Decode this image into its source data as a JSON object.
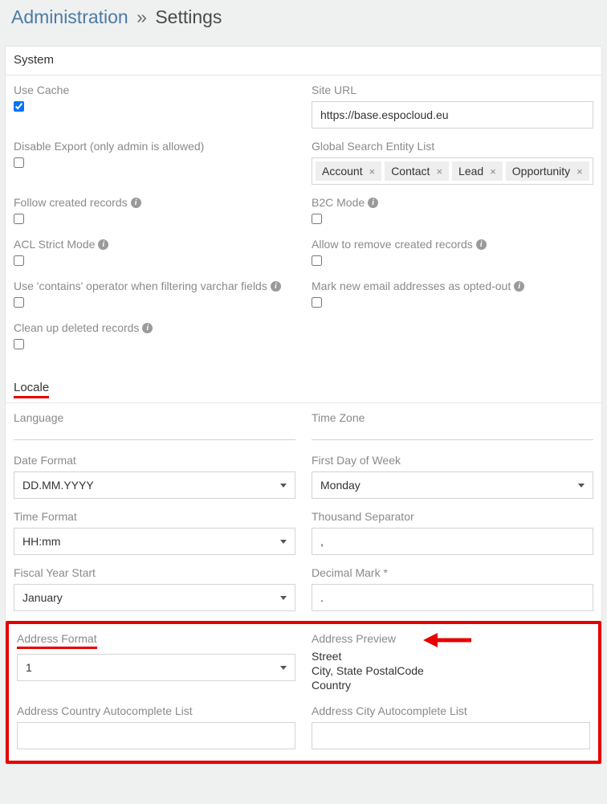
{
  "header": {
    "admin_link": "Administration",
    "separator": "»",
    "page_title": "Settings"
  },
  "sections": {
    "system": {
      "title": "System",
      "use_cache": {
        "label": "Use Cache",
        "checked": true
      },
      "site_url": {
        "label": "Site URL",
        "value": "https://base.espocloud.eu"
      },
      "disable_export": {
        "label": "Disable Export (only admin is allowed)",
        "checked": false
      },
      "global_search": {
        "label": "Global Search Entity List",
        "tags": [
          "Account",
          "Contact",
          "Lead",
          "Opportunity"
        ]
      },
      "follow_created": {
        "label": "Follow created records",
        "checked": false
      },
      "b2c_mode": {
        "label": "B2C Mode",
        "checked": false
      },
      "acl_strict": {
        "label": "ACL Strict Mode",
        "checked": false
      },
      "allow_remove_created": {
        "label": "Allow to remove created records",
        "checked": false
      },
      "contains_operator": {
        "label": "Use 'contains' operator when filtering varchar fields",
        "checked": false
      },
      "mark_opted_out": {
        "label": "Mark new email addresses as opted-out",
        "checked": false
      },
      "clean_deleted": {
        "label": "Clean up deleted records",
        "checked": false
      }
    },
    "locale": {
      "title": "Locale",
      "language": {
        "label": "Language",
        "value": ""
      },
      "time_zone": {
        "label": "Time Zone",
        "value": ""
      },
      "date_format": {
        "label": "Date Format",
        "value": "DD.MM.YYYY"
      },
      "first_day": {
        "label": "First Day of Week",
        "value": "Monday"
      },
      "time_format": {
        "label": "Time Format",
        "value": "HH:mm"
      },
      "thousand_sep": {
        "label": "Thousand Separator",
        "value": ","
      },
      "fiscal_year": {
        "label": "Fiscal Year Start",
        "value": "January"
      },
      "decimal_mark": {
        "label": "Decimal Mark *",
        "value": "."
      },
      "address_format": {
        "label": "Address Format",
        "value": "1"
      },
      "address_preview": {
        "label": "Address Preview",
        "lines": [
          "Street",
          "City, State PostalCode",
          "Country"
        ]
      },
      "addr_country_auto": {
        "label": "Address Country Autocomplete List",
        "value": ""
      },
      "addr_city_auto": {
        "label": "Address City Autocomplete List",
        "value": ""
      }
    }
  }
}
